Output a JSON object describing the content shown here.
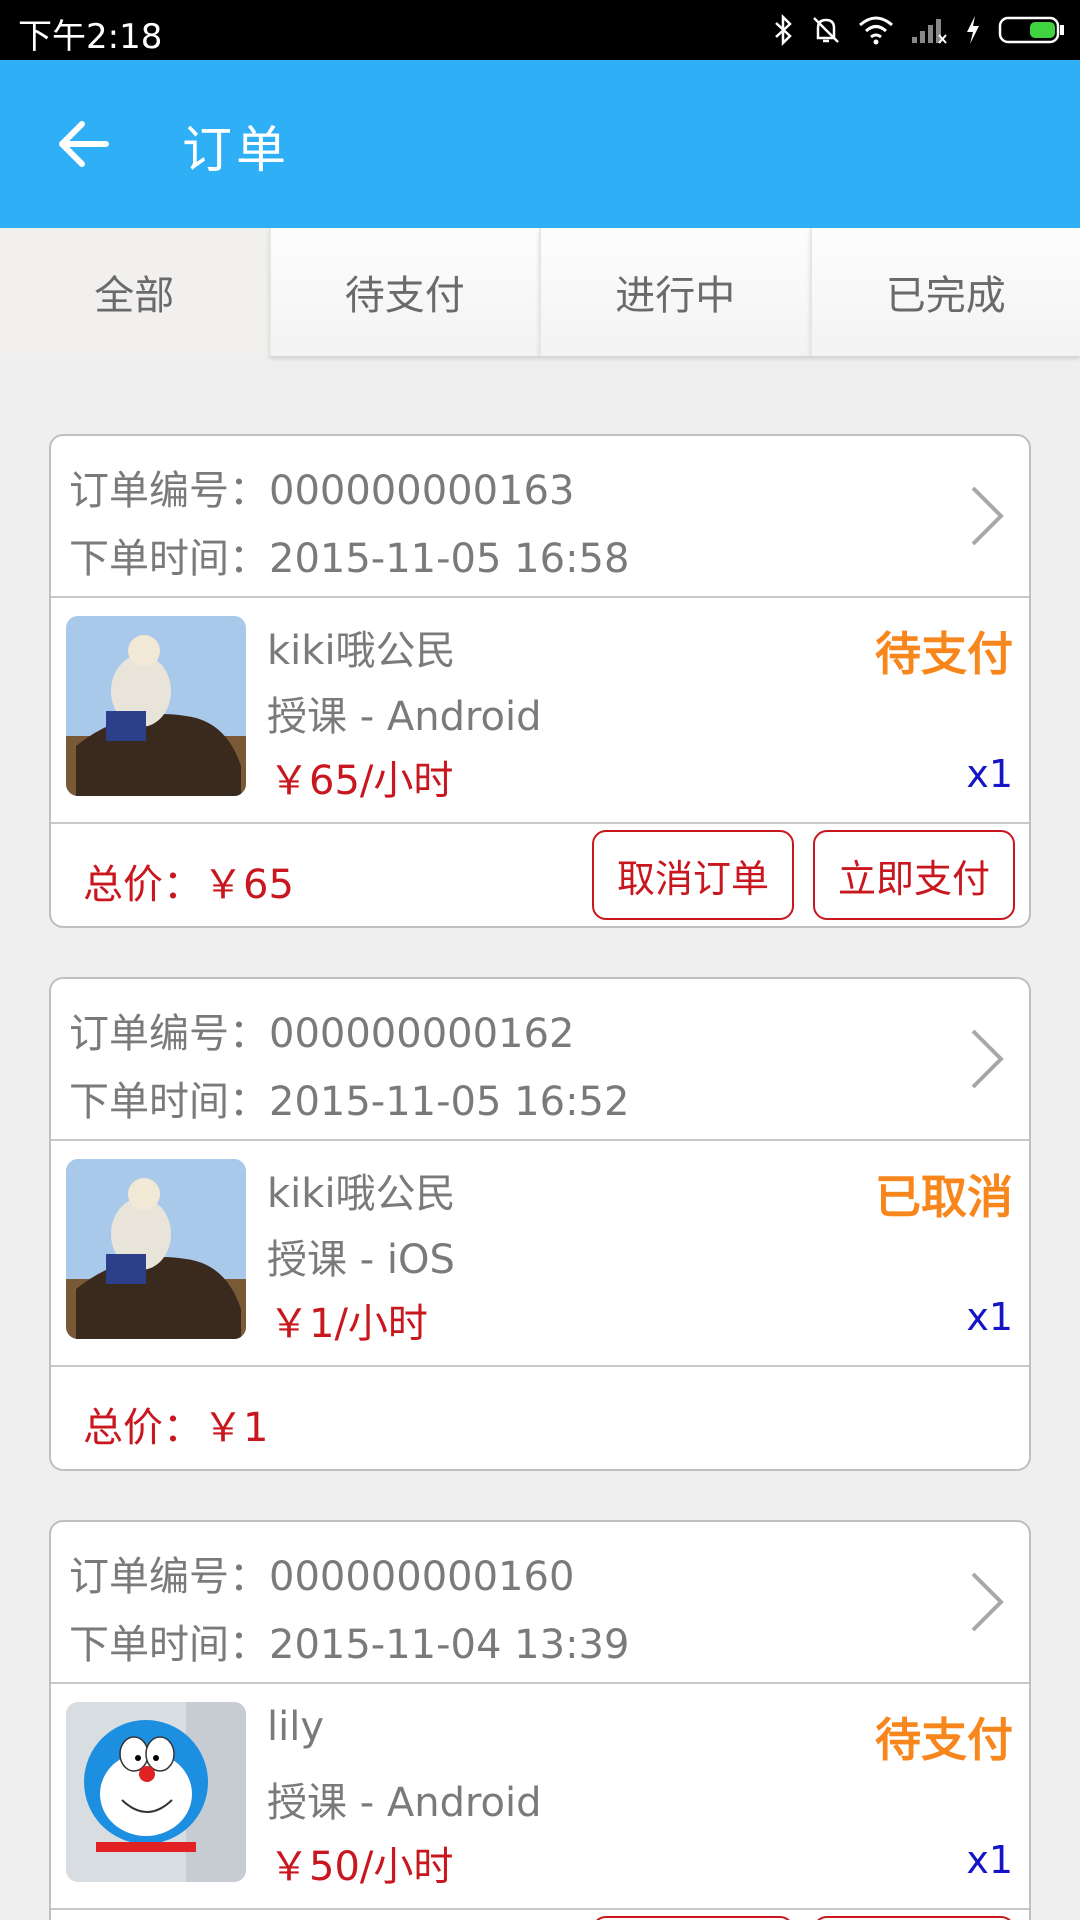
{
  "status_bar": {
    "time": "下午2:18",
    "icons": [
      "bluetooth-icon",
      "muted-bell-icon",
      "wifi-icon",
      "signal-icon",
      "charging-icon",
      "battery-icon"
    ]
  },
  "app_bar": {
    "title": "订单"
  },
  "tabs": [
    {
      "label": "全部",
      "active": true
    },
    {
      "label": "待支付",
      "active": false
    },
    {
      "label": "进行中",
      "active": false
    },
    {
      "label": "已完成",
      "active": false
    }
  ],
  "labels": {
    "order_no_prefix": "订单编号：",
    "order_time_prefix": "下单时间：",
    "total_prefix": "总价：",
    "cancel_button": "取消订单",
    "pay_button": "立即支付"
  },
  "orders": [
    {
      "order_no": "订单编号：000000000163",
      "order_time": "下单时间：2015-11-05 16:58",
      "name": "kiki哦公民",
      "course": "授课 - Android",
      "price": "￥65/小时",
      "status": "待支付",
      "qty": "x1",
      "total": "总价：￥65",
      "cancel": "取消订单",
      "pay": "立即支付"
    },
    {
      "order_no": "订单编号：000000000162",
      "order_time": "下单时间：2015-11-05 16:52",
      "name": "kiki哦公民",
      "course": "授课 - iOS",
      "price": "￥1/小时",
      "status": "已取消",
      "qty": "x1",
      "total": "总价：￥1"
    },
    {
      "order_no": "订单编号：000000000160",
      "order_time": "下单时间：2015-11-04 13:39",
      "name": "lily",
      "course": "授课 - Android",
      "price": "￥50/小时",
      "status": "待支付",
      "qty": "x1"
    }
  ],
  "colors": {
    "app_bar": "#2fb0f6",
    "status_pending": "#f7861c",
    "price_red": "#c8171e",
    "qty_blue": "#1515c8"
  }
}
